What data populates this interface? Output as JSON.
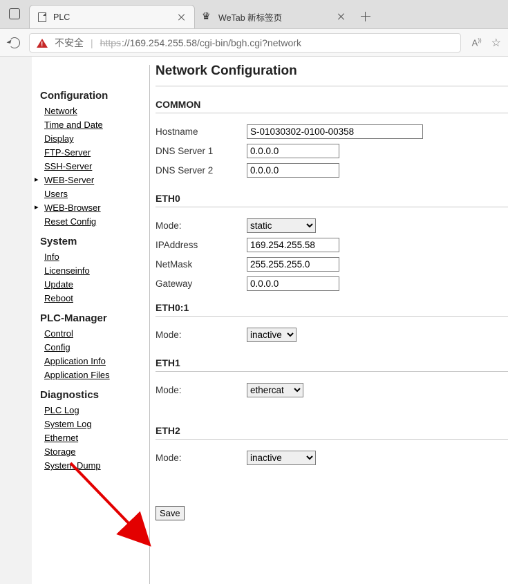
{
  "browser": {
    "tabs": [
      {
        "title": "PLC",
        "active": true
      },
      {
        "title": "WeTab 新标签页",
        "active": false
      }
    ],
    "security_label": "不安全",
    "url_scheme": "https",
    "url_rest": "://169.254.255.58/cgi-bin/bgh.cgi?network"
  },
  "sidebar": {
    "configuration": {
      "heading": "Configuration",
      "items": [
        "Network",
        "Time and Date",
        "Display",
        "FTP-Server",
        "SSH-Server",
        "WEB-Server",
        "Users",
        "WEB-Browser",
        "Reset Config"
      ]
    },
    "system": {
      "heading": "System",
      "items": [
        "Info",
        "Licenseinfo",
        "Update",
        "Reboot"
      ]
    },
    "plcmgr": {
      "heading": "PLC-Manager",
      "items": [
        "Control",
        "Config",
        "Application Info",
        "Application Files"
      ]
    },
    "diag": {
      "heading": "Diagnostics",
      "items": [
        "PLC Log",
        "System Log",
        "Ethernet",
        "Storage",
        "System Dump"
      ]
    }
  },
  "page": {
    "title": "Network Configuration",
    "common": {
      "heading": "COMMON",
      "hostname_label": "Hostname",
      "hostname": "S-01030302-0100-00358",
      "dns1_label": "DNS Server 1",
      "dns1": "0.0.0.0",
      "dns2_label": "DNS Server 2",
      "dns2": "0.0.0.0"
    },
    "eth0": {
      "heading": "ETH0",
      "mode_label": "Mode:",
      "mode": "static",
      "ip_label": "IPAddress",
      "ip": "169.254.255.58",
      "mask_label": "NetMask",
      "mask": "255.255.255.0",
      "gw_label": "Gateway",
      "gw": "0.0.0.0"
    },
    "eth0_1": {
      "heading": "ETH0:1",
      "mode_label": "Mode:",
      "mode": "inactive"
    },
    "eth1": {
      "heading": "ETH1",
      "mode_label": "Mode:",
      "mode": "ethercat"
    },
    "eth2": {
      "heading": "ETH2",
      "mode_label": "Mode:",
      "mode": "inactive"
    },
    "save_label": "Save"
  }
}
